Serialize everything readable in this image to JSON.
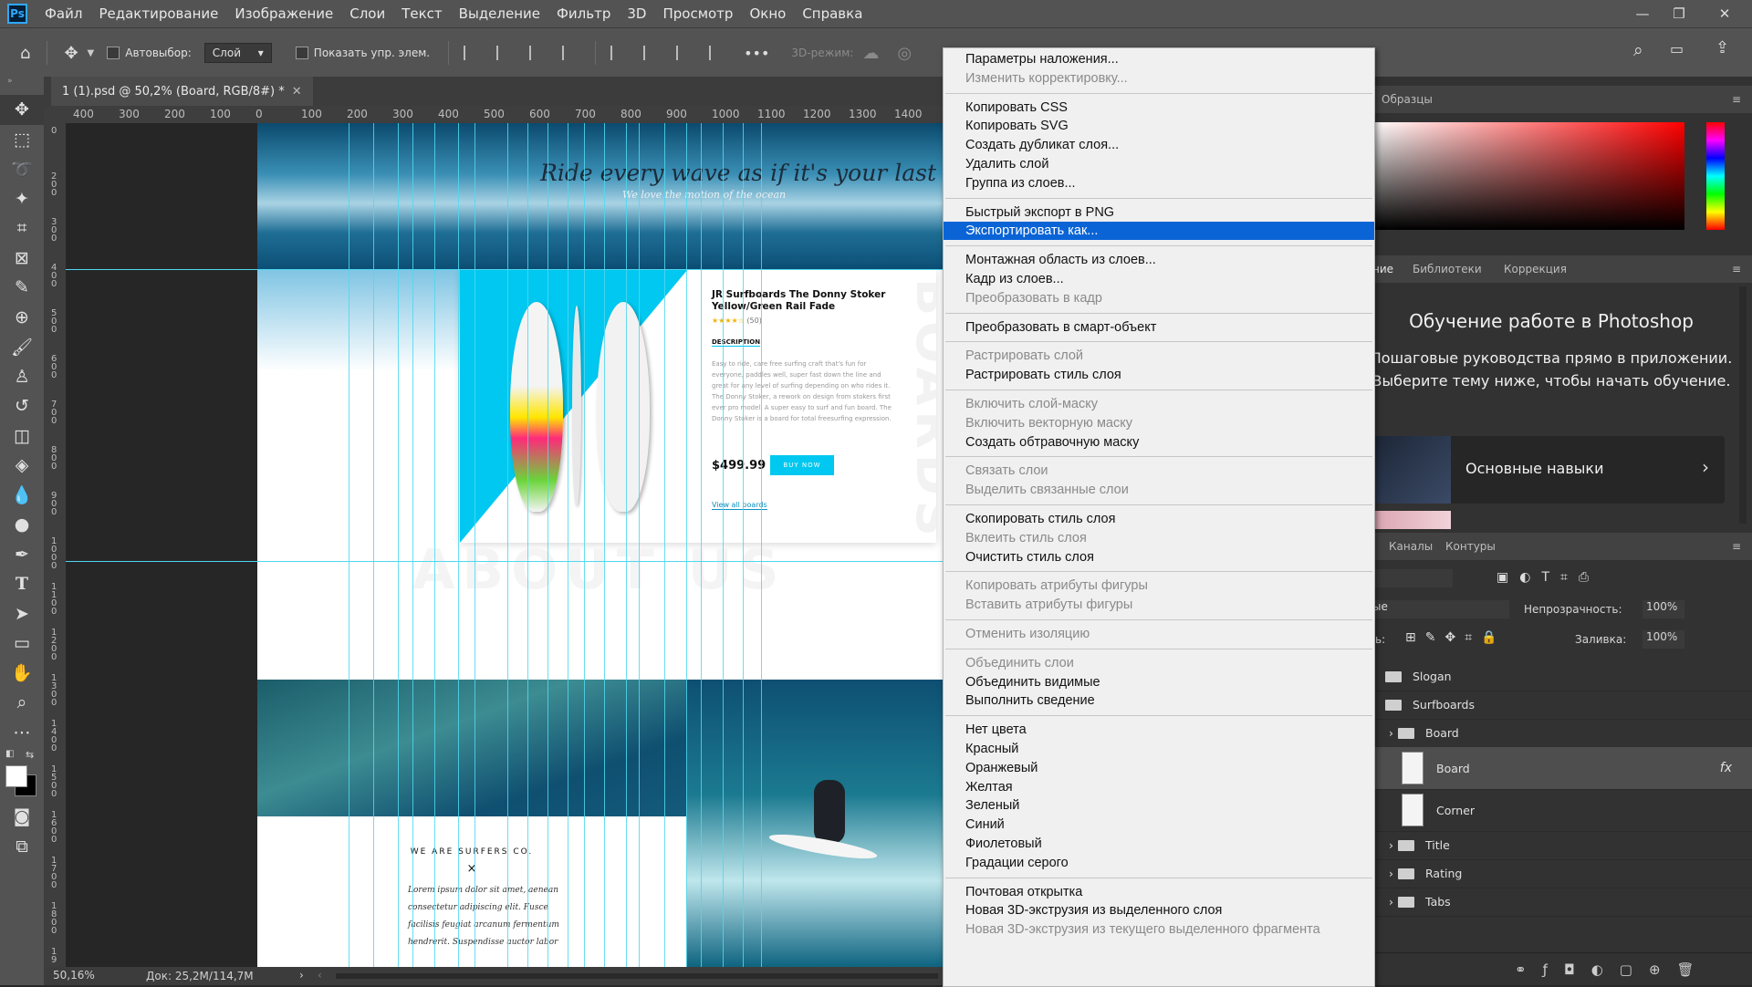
{
  "menubar": {
    "logo": "Ps",
    "items": [
      "Файл",
      "Редактирование",
      "Изображение",
      "Слои",
      "Текст",
      "Выделение",
      "Фильтр",
      "3D",
      "Просмотр",
      "Окно",
      "Справка"
    ]
  },
  "options": {
    "autoselect_label": "Автовыбор:",
    "autoselect_value": "Слой",
    "show_controls_label": "Показать упр. элем.",
    "mode3d_label": "3D-режим:"
  },
  "document": {
    "tab_title": "1 (1).psd @ 50,2% (Board, RGB/8#) *"
  },
  "rulers": {
    "h": [
      "400",
      "300",
      "200",
      "100",
      "0",
      "100",
      "200",
      "300",
      "400",
      "500",
      "600",
      "700",
      "800",
      "900",
      "1000",
      "1100",
      "1200",
      "1300",
      "1400"
    ],
    "v": [
      "0",
      "2 0 0",
      "3 0 0",
      "4 0 0",
      "5 0 0",
      "6 0 0",
      "7 0 0",
      "8 0 0",
      "9 0 0",
      "1 0 0 0",
      "1 1 0 0",
      "1 2 0 0",
      "1 3 0 0",
      "1 4 0 0",
      "1 5 0 0",
      "1 6 0 0",
      "1 7 0 0",
      "1 8 0 0",
      "1 9"
    ]
  },
  "artboard": {
    "hero_title": "Ride every wave as if it's your last",
    "hero_subtitle": "We love the motion of the ocean",
    "product_title": "JR Surfboards The Donny Stoker Yellow/Green Rail Fade",
    "rating_count": "(50)",
    "description_label": "DESCRIPTION",
    "description_text": "Easy to ride, care free surfing craft that's fun for everyone, paddles well, super fast down the line and great for any level of surfing depending on who rides it. The Donny Stoker, a rework on design from stokers first ever pro model. A super easy to surf and fun board. The Donny Stoker is a board for total freesurfing expression.",
    "price": "$499.99",
    "buy_label": "BUY NOW",
    "view_all": "View all boards",
    "side_word": "BOARDS",
    "about_word": "ABOUT US",
    "we_are": "WE ARE SURFERS CO.",
    "x_mark": "×",
    "lorem": "Lorem ipsum dolor sit amet, aenean consectetur adipiscing elit. Fusce facilisis feugiat arcanum fermentum hendrerit. Suspendisse auctor labor"
  },
  "status": {
    "zoom": "50,16%",
    "doc": "Док: 25,2M/114,7M"
  },
  "context_menu": [
    {
      "label": "Параметры наложения...",
      "dis": false
    },
    {
      "label": "Изменить корректировку...",
      "dis": true
    },
    {
      "sep": true
    },
    {
      "label": "Копировать CSS",
      "dis": false
    },
    {
      "label": "Копировать SVG",
      "dis": false
    },
    {
      "label": "Создать дубликат слоя...",
      "dis": false
    },
    {
      "label": "Удалить слой",
      "dis": false
    },
    {
      "label": "Группа из слоев...",
      "dis": false
    },
    {
      "sep": true
    },
    {
      "label": "Быстрый экспорт в PNG",
      "dis": false
    },
    {
      "label": "Экспортировать как...",
      "dis": false,
      "hl": true
    },
    {
      "sep": true
    },
    {
      "label": "Монтажная область из слоев...",
      "dis": false
    },
    {
      "label": "Кадр из слоев...",
      "dis": false
    },
    {
      "label": "Преобразовать в кадр",
      "dis": true
    },
    {
      "sep": true
    },
    {
      "label": "Преобразовать в смарт-объект",
      "dis": false
    },
    {
      "sep": true
    },
    {
      "label": "Растрировать слой",
      "dis": true
    },
    {
      "label": "Растрировать стиль слоя",
      "dis": false
    },
    {
      "sep": true
    },
    {
      "label": "Включить слой-маску",
      "dis": true
    },
    {
      "label": "Включить векторную маску",
      "dis": true
    },
    {
      "label": "Создать обтравочную маску",
      "dis": false
    },
    {
      "sep": true
    },
    {
      "label": "Связать слои",
      "dis": true
    },
    {
      "label": "Выделить связанные слои",
      "dis": true
    },
    {
      "sep": true
    },
    {
      "label": "Скопировать стиль слоя",
      "dis": false
    },
    {
      "label": "Вклеить стиль слоя",
      "dis": true
    },
    {
      "label": "Очистить стиль слоя",
      "dis": false
    },
    {
      "sep": true
    },
    {
      "label": "Копировать атрибуты фигуры",
      "dis": true
    },
    {
      "label": "Вставить атрибуты фигуры",
      "dis": true
    },
    {
      "sep": true
    },
    {
      "label": "Отменить изоляцию",
      "dis": true
    },
    {
      "sep": true
    },
    {
      "label": "Объединить слои",
      "dis": true
    },
    {
      "label": "Объединить видимые",
      "dis": false
    },
    {
      "label": "Выполнить сведение",
      "dis": false
    },
    {
      "sep": true
    },
    {
      "label": "Нет цвета",
      "dis": false
    },
    {
      "label": "Красный",
      "dis": false
    },
    {
      "label": "Оранжевый",
      "dis": false
    },
    {
      "label": "Желтая",
      "dis": false
    },
    {
      "label": "Зеленый",
      "dis": false
    },
    {
      "label": "Синий",
      "dis": false
    },
    {
      "label": "Фиолетовый",
      "dis": false
    },
    {
      "label": "Градации серого",
      "dis": false
    },
    {
      "sep": true
    },
    {
      "label": "Почтовая открытка",
      "dis": false
    },
    {
      "label": "Новая 3D-экструзия из выделенного слоя",
      "dis": false
    },
    {
      "label": "Новая 3D-экструзия из текущего выделенного фрагмента",
      "dis": true
    }
  ],
  "panels": {
    "swatches_tab": "Образцы",
    "learn_tabs": [
      "ние",
      "Библиотеки",
      "Коррекция"
    ],
    "learn_title": "Обучение работе в Photoshop",
    "learn_text": "Пошаговые руководства прямо в приложении. Выберите тему ниже, чтобы начать обучение.",
    "learn_card": "Основные навыки",
    "layers_tabs": [
      "Каналы",
      "Контуры"
    ],
    "blend_mode": "ые",
    "opacity_label": "Непрозрачность:",
    "opacity_value": "100%",
    "lock_label": "ть:",
    "fill_label": "Заливка:",
    "fill_value": "100%",
    "layers": [
      {
        "name": "Slogan",
        "type": "folder",
        "indent": 0
      },
      {
        "name": "Surfboards",
        "type": "folder",
        "indent": 0
      },
      {
        "name": "Board",
        "type": "folder",
        "indent": 1
      },
      {
        "name": "Board",
        "type": "layer",
        "indent": 2,
        "selected": true,
        "fx": "fx"
      },
      {
        "name": "Corner",
        "type": "layer",
        "indent": 2
      },
      {
        "name": "Title",
        "type": "folder",
        "indent": 1
      },
      {
        "name": "Rating",
        "type": "folder",
        "indent": 1
      },
      {
        "name": "Tabs",
        "type": "folder",
        "indent": 1
      }
    ]
  },
  "colors": {
    "accent": "#0a64d6",
    "cyan": "#00c8f0",
    "ui_dark": "#535353",
    "panel": "#323232"
  }
}
